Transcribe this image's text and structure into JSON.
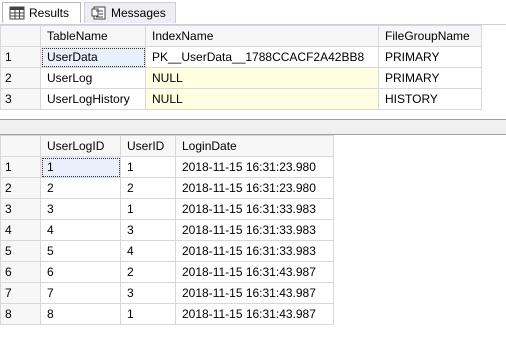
{
  "tabs": [
    {
      "label": "Results",
      "icon": "grid-icon",
      "active": true
    },
    {
      "label": "Messages",
      "icon": "messages-icon",
      "active": false
    }
  ],
  "grid1": {
    "columns": [
      "TableName",
      "IndexName",
      "FileGroupName"
    ],
    "rows": [
      {
        "num": "1",
        "cells": [
          "UserData",
          "PK__UserData__1788CCACF2A42BB8",
          "PRIMARY"
        ]
      },
      {
        "num": "2",
        "cells": [
          "UserLog",
          "NULL",
          "PRIMARY"
        ]
      },
      {
        "num": "3",
        "cells": [
          "UserLogHistory",
          "NULL",
          "HISTORY"
        ]
      }
    ]
  },
  "grid2": {
    "columns": [
      "UserLogID",
      "UserID",
      "LoginDate"
    ],
    "rows": [
      {
        "num": "1",
        "cells": [
          "1",
          "1",
          "2018-11-15 16:31:23.980"
        ]
      },
      {
        "num": "2",
        "cells": [
          "2",
          "2",
          "2018-11-15 16:31:23.980"
        ]
      },
      {
        "num": "3",
        "cells": [
          "3",
          "1",
          "2018-11-15 16:31:33.983"
        ]
      },
      {
        "num": "4",
        "cells": [
          "4",
          "3",
          "2018-11-15 16:31:33.983"
        ]
      },
      {
        "num": "5",
        "cells": [
          "5",
          "4",
          "2018-11-15 16:31:33.983"
        ]
      },
      {
        "num": "6",
        "cells": [
          "6",
          "2",
          "2018-11-15 16:31:43.987"
        ]
      },
      {
        "num": "7",
        "cells": [
          "7",
          "3",
          "2018-11-15 16:31:43.987"
        ]
      },
      {
        "num": "8",
        "cells": [
          "8",
          "1",
          "2018-11-15 16:31:43.987"
        ]
      }
    ]
  }
}
